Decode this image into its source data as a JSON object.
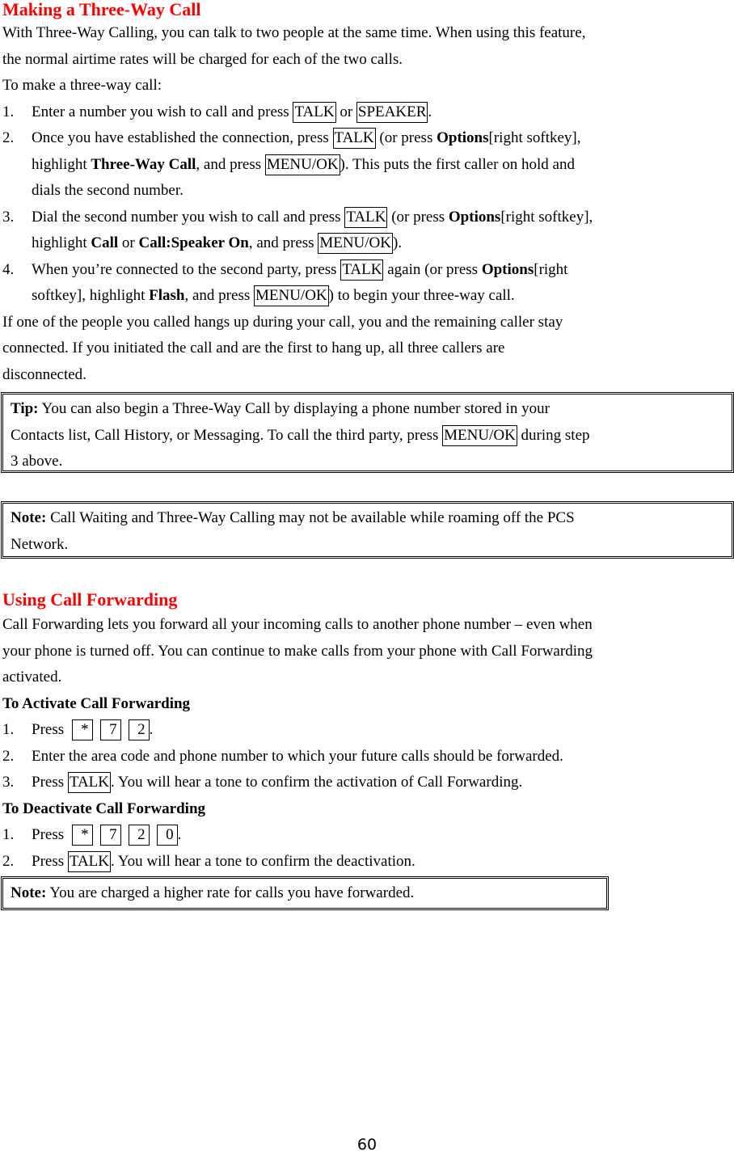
{
  "section1": {
    "title": "Making a Three-Way Call",
    "intro_line1": "With Three-Way Calling, you can talk to two people at the same time. When using this feature,",
    "intro_line2": "the normal airtime rates will be charged for each of the two calls.",
    "lead": "To make a three-way call:",
    "steps": [
      {
        "num": "1.",
        "t1": "Enter a number you wish to call and press ",
        "k1": "TALK",
        "t2": " or ",
        "k2": "SPEAKER",
        "t3": "."
      },
      {
        "num": "2.",
        "t1": "Once you have established the connection, press ",
        "k1": "TALK",
        "t2": " (or press ",
        "b1": "Options",
        "t3": "[right softkey],",
        "t4": "highlight ",
        "b2": "Three-Way Call",
        "t5": ", and press ",
        "k2": "MENU/OK",
        "t6": "). This puts the first caller on hold and",
        "t7": "dials the second number."
      },
      {
        "num": "3.",
        "t1": "Dial the second number you wish to call and press ",
        "k1": "TALK",
        "t2": " (or press ",
        "b1": "Options",
        "t3": "[right softkey],",
        "t4": "highlight ",
        "b2": "Call",
        "t5": " or ",
        "b3": "Call:Speaker On",
        "t6": ", and press ",
        "k2": "MENU/OK",
        "t7": ")."
      },
      {
        "num": "4.",
        "t1": "When you’re connected to the second party, press ",
        "k1": "TALK",
        "t2": " again (or press ",
        "b1": "Options",
        "t3": "[right",
        "t4": "softkey], highlight ",
        "b2": "Flash",
        "t5": ", and press ",
        "k2": "MENU/OK",
        "t6": ") to begin your three-way call."
      }
    ],
    "after_line1": "If one of the people you called hangs up during your call, you and the remaining caller stay",
    "after_line2": "connected. If you initiated the call and are the first to hang up, all three callers are",
    "after_line3": "disconnected.",
    "tip": {
      "label": "Tip:",
      "line1": " You can also begin a Three-Way Call by displaying a phone number stored in your",
      "line2a": "Contacts list, Call History, or Messaging. To call the third party, press ",
      "key": "MENU/OK",
      "line2b": " during step",
      "line3": "3 above."
    },
    "note": {
      "label": "Note:",
      "line1": " Call Waiting and Three-Way Calling may not be available while roaming off the PCS",
      "line2": "Network."
    }
  },
  "section2": {
    "title": "Using Call Forwarding",
    "intro_line1": "Call Forwarding lets you forward all your incoming calls to another phone number – even when",
    "intro_line2": "your phone is turned off. You can continue to make calls from your phone with Call Forwarding",
    "intro_line3": "activated.",
    "activate": {
      "heading": "To Activate Call Forwarding",
      "step1_num": "1.",
      "step1_text": "Press ",
      "step1_keys": [
        "*",
        "7",
        "2"
      ],
      "step1_end": ".",
      "step2_num": "2.",
      "step2_text": "Enter the area code and phone number to which your future calls should be forwarded.",
      "step3_num": "3.",
      "step3_t1": "Press ",
      "step3_key": "TALK",
      "step3_t2": ". You will hear a tone to confirm the activation of Call Forwarding."
    },
    "deactivate": {
      "heading": "To Deactivate Call Forwarding",
      "step1_num": "1.",
      "step1_text": "Press ",
      "step1_keys": [
        "*",
        "7",
        "2",
        "0"
      ],
      "step1_end": ".",
      "step2_num": "2.",
      "step2_t1": "Press ",
      "step2_key": "TALK",
      "step2_t2": ". You will hear a tone to confirm the deactivation."
    },
    "note": {
      "label": "Note:",
      "text": " You are charged a higher rate for calls you have forwarded."
    }
  },
  "page_number": "60"
}
